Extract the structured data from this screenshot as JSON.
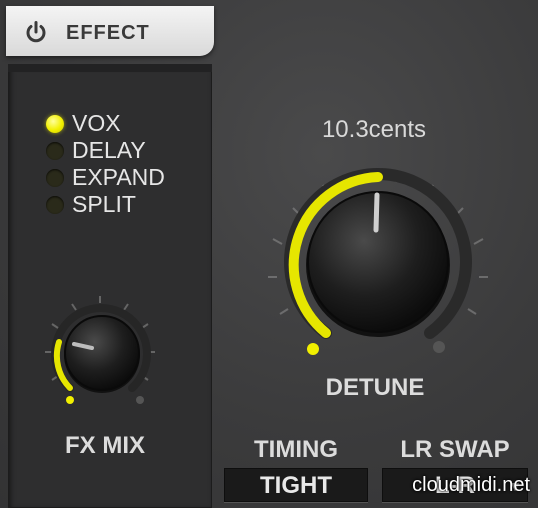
{
  "header": {
    "title": "EFFECT"
  },
  "modes": [
    {
      "label": "VOX",
      "active": true
    },
    {
      "label": "DELAY",
      "active": false
    },
    {
      "label": "EXPAND",
      "active": false
    },
    {
      "label": "SPLIT",
      "active": false
    }
  ],
  "detune": {
    "readout": "10.3cents",
    "label": "DETUNE"
  },
  "fx_mix": {
    "label": "FX MIX"
  },
  "timing": {
    "label": "TIMING",
    "value": "TIGHT"
  },
  "lr_swap": {
    "label": "LR SWAP",
    "value": "L-R",
    "arrow": "▼"
  },
  "watermark": "cloudmidi.net",
  "colors": {
    "accent": "#f2f000",
    "panel": "#2e2e2f",
    "background": "#3b3b3c"
  }
}
